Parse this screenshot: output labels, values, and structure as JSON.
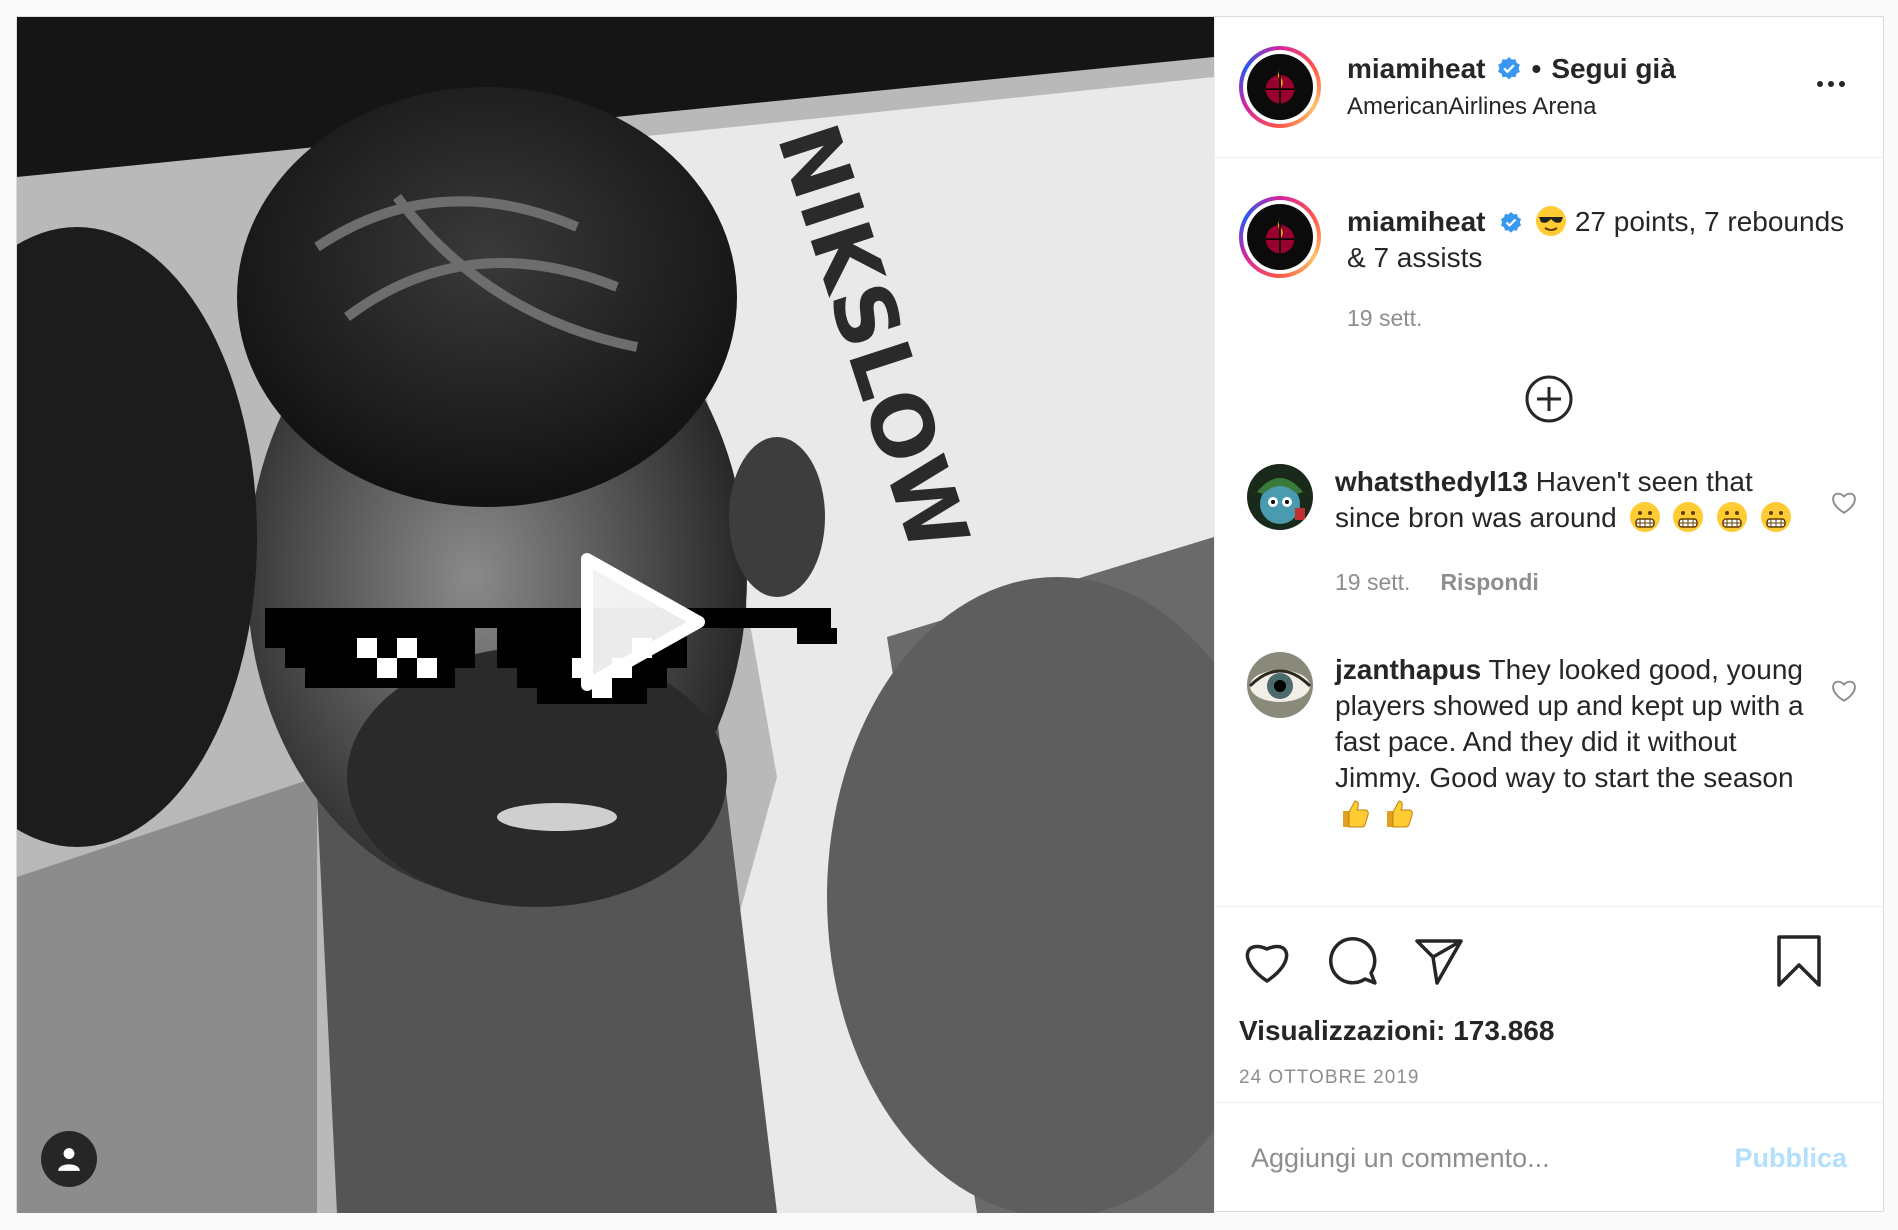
{
  "post": {
    "author": "miamiheat",
    "follow_state": "Segui già",
    "location": "AmericanAirlines Arena",
    "caption": {
      "username": "miamiheat",
      "emoji": "sunglasses-emoji",
      "text": "27 points, 7 rebounds & 7 assists",
      "time": "19 sett."
    },
    "comments": [
      {
        "username": "whatsthedyl13",
        "text": "Haven't seen that since bron was around",
        "emoji": "grimacing-emoji",
        "emoji_count": 4,
        "time": "19 sett.",
        "reply_label": "Rispondi"
      },
      {
        "username": "jzanthapus",
        "text": "They looked good, young players showed up and kept up with a fast pace. And they did it without Jimmy. Good way to start the season",
        "emoji": "thumbs-up-emoji",
        "emoji_count": 2
      }
    ],
    "views_label": "Visualizzazioni: 173.868",
    "date": "24 OTTOBRE 2019",
    "comment_placeholder": "Aggiungi un commento...",
    "publish_label": "Pubblica",
    "separator": "•"
  },
  "colors": {
    "verified_blue": "#3897f0",
    "publish_disabled": "#b2dffc",
    "muted_text": "#8e8e8e",
    "heat_red": "#98002e"
  }
}
